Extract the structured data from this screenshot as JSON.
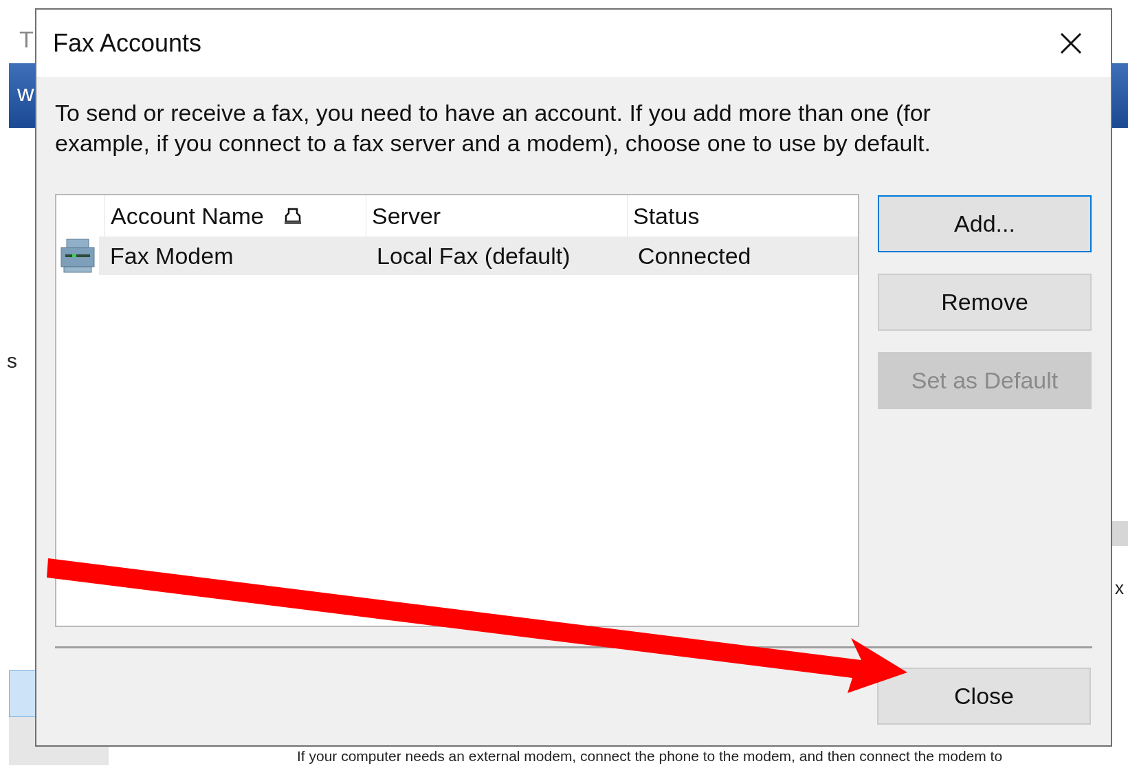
{
  "background": {
    "fragments": [
      {
        "text": "T",
        "kind": "plain"
      },
      {
        "text": "w",
        "kind": "bar"
      },
      {
        "text": "s",
        "kind": "plain"
      },
      {
        "text": "x",
        "kind": "plain"
      }
    ],
    "footer_text": "If your computer needs an external modem, connect the phone to the modem, and then connect the modem to"
  },
  "window": {
    "title": "Fax Accounts"
  },
  "intro": "To send or receive a fax, you need to have an account. If you add more than one (for example, if you connect to a fax server and a modem), choose one to use by default.",
  "table": {
    "columns": [
      "Account Name",
      "Server",
      "Status"
    ],
    "rows": [
      {
        "cells": [
          "Fax Modem",
          "Local Fax (default)",
          "Connected"
        ],
        "selected": true
      }
    ]
  },
  "buttons": [
    {
      "label": "Add...",
      "default": true,
      "disabled": false
    },
    {
      "label": "Remove",
      "default": false,
      "disabled": false
    },
    {
      "label": "Set as Default",
      "default": false,
      "disabled": true
    }
  ],
  "close_button": {
    "label": "Close"
  }
}
